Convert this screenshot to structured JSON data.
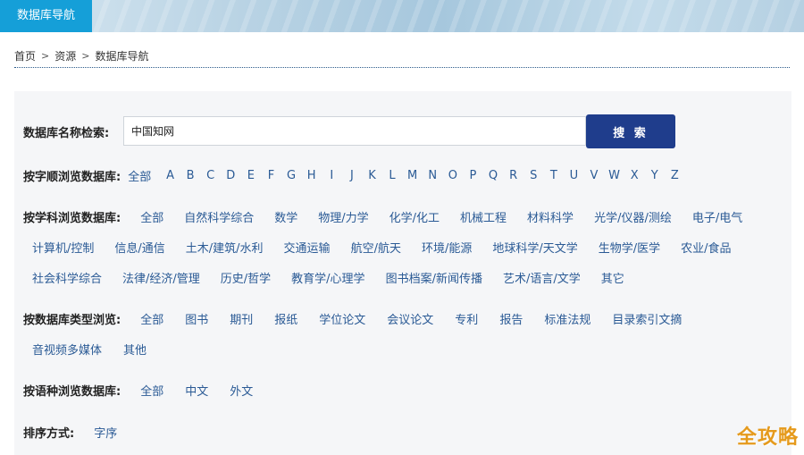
{
  "banner": {
    "tab_label": "数据库导航"
  },
  "breadcrumb": {
    "items": [
      "首页",
      "资源",
      "数据库导航"
    ],
    "separator": ">"
  },
  "search": {
    "label": "数据库名称检索:",
    "value": "中国知网",
    "button_label": "搜 索"
  },
  "alpha": {
    "label": "按字顺浏览数据库:",
    "all": "全部",
    "letters": [
      "A",
      "B",
      "C",
      "D",
      "E",
      "F",
      "G",
      "H",
      "I",
      "J",
      "K",
      "L",
      "M",
      "N",
      "O",
      "P",
      "Q",
      "R",
      "S",
      "T",
      "U",
      "V",
      "W",
      "X",
      "Y",
      "Z"
    ]
  },
  "subject": {
    "label": "按学科浏览数据库:",
    "row1": [
      "全部",
      "自然科学综合",
      "数学",
      "物理/力学",
      "化学/化工",
      "机械工程",
      "材料科学",
      "光学/仪器/测绘",
      "电子/电气"
    ],
    "row2": [
      "计算机/控制",
      "信息/通信",
      "土木/建筑/水利",
      "交通运输",
      "航空/航天",
      "环境/能源",
      "地球科学/天文学",
      "生物学/医学",
      "农业/食品"
    ],
    "row3": [
      "社会科学综合",
      "法律/经济/管理",
      "历史/哲学",
      "教育学/心理学",
      "图书档案/新闻传播",
      "艺术/语言/文学",
      "其它"
    ]
  },
  "dbtype": {
    "label": "按数据库类型浏览:",
    "row1": [
      "全部",
      "图书",
      "期刊",
      "报纸",
      "学位论文",
      "会议论文",
      "专利",
      "报告",
      "标准法规",
      "目录索引文摘"
    ],
    "row2": [
      "音视频多媒体",
      "其他"
    ]
  },
  "language": {
    "label": "按语种浏览数据库:",
    "items": [
      "全部",
      "中文",
      "外文"
    ]
  },
  "sort": {
    "label": "排序方式:",
    "items": [
      "字序"
    ]
  },
  "watermark": "全攻略",
  "colors": {
    "tab": "#159fd8",
    "button": "#1f3d8c",
    "link": "#2a5a95",
    "panel": "#f5f6f8"
  }
}
